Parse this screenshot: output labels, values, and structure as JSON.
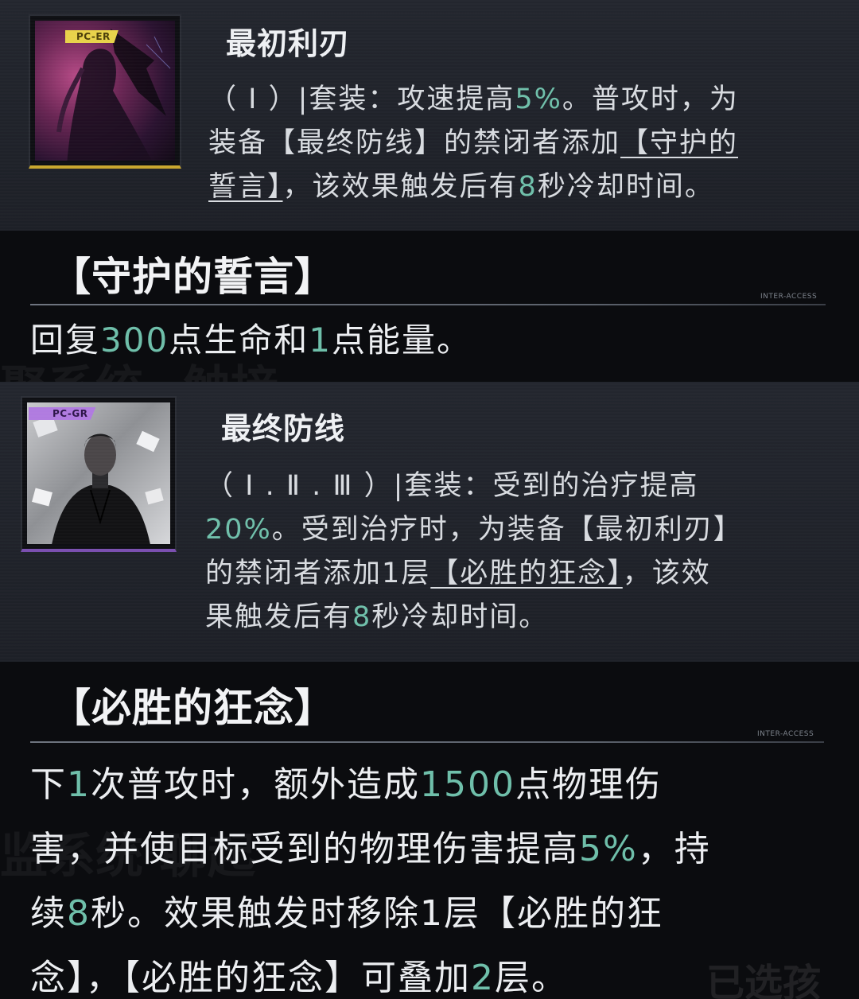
{
  "cards": [
    {
      "tag": "PC-ER",
      "title": "最初利刃",
      "desc": [
        [
          {
            "t": "（ Ⅰ ）|套装：攻速提高"
          },
          {
            "t": "5%",
            "hl": true
          },
          {
            "t": "。普攻时，为"
          }
        ],
        [
          {
            "t": "装备【最终防线】的禁闭者添加"
          },
          {
            "t": "【守护的",
            "ul": true
          }
        ],
        [
          {
            "t": "誓言】",
            "ul": true
          },
          {
            "t": "，该效果触发后有"
          },
          {
            "t": "8",
            "hl": true
          },
          {
            "t": "秒冷却时间。"
          }
        ]
      ]
    },
    {
      "tag": "PC-GR",
      "title": "最终防线",
      "desc": [
        [
          {
            "t": "（ Ⅰ . Ⅱ . Ⅲ ）|套装：受到的治疗提高"
          }
        ],
        [
          {
            "t": "20%",
            "hl": true
          },
          {
            "t": "。受到治疗时，为装备【最初利刃】"
          }
        ],
        [
          {
            "t": "的禁闭者添加1层"
          },
          {
            "t": "【必胜的狂念】",
            "ul": true
          },
          {
            "t": "，该效"
          }
        ],
        [
          {
            "t": "果触发后有"
          },
          {
            "t": "8",
            "hl": true
          },
          {
            "t": "秒冷却时间。"
          }
        ]
      ]
    }
  ],
  "sections": [
    {
      "title": "【守护的誓言】",
      "inter_label": "INTER-ACCESS",
      "body": [
        [
          {
            "t": "回复"
          },
          {
            "t": "300",
            "hl": true
          },
          {
            "t": "点生命和"
          },
          {
            "t": "1",
            "hl": true
          },
          {
            "t": "点能量。"
          }
        ]
      ]
    },
    {
      "title": "【必胜的狂念】",
      "inter_label": "INTER-ACCESS",
      "body": [
        [
          {
            "t": "下"
          },
          {
            "t": "1",
            "hl": true
          },
          {
            "t": "次普攻时，额外造成"
          },
          {
            "t": "1500",
            "hl": true
          },
          {
            "t": "点物理伤"
          }
        ],
        [
          {
            "t": "害，并使目标受到的物理伤害提高"
          },
          {
            "t": "5%",
            "hl": true
          },
          {
            "t": "，持"
          }
        ],
        [
          {
            "t": "续"
          },
          {
            "t": "8",
            "hl": true
          },
          {
            "t": "秒。效果触发时移除1层【必胜的狂"
          }
        ],
        [
          {
            "t": "念】，【必胜的狂念】可叠加"
          },
          {
            "t": "2",
            "hl": true
          },
          {
            "t": "层。"
          }
        ]
      ]
    }
  ],
  "ghost_text": [
    "聚系统=触接",
    "监系统 聊起",
    "已选孩"
  ],
  "colors": {
    "highlight": "#6fbfaa",
    "tag_er": "#e8d24a",
    "tag_gr": "#b07be0"
  }
}
